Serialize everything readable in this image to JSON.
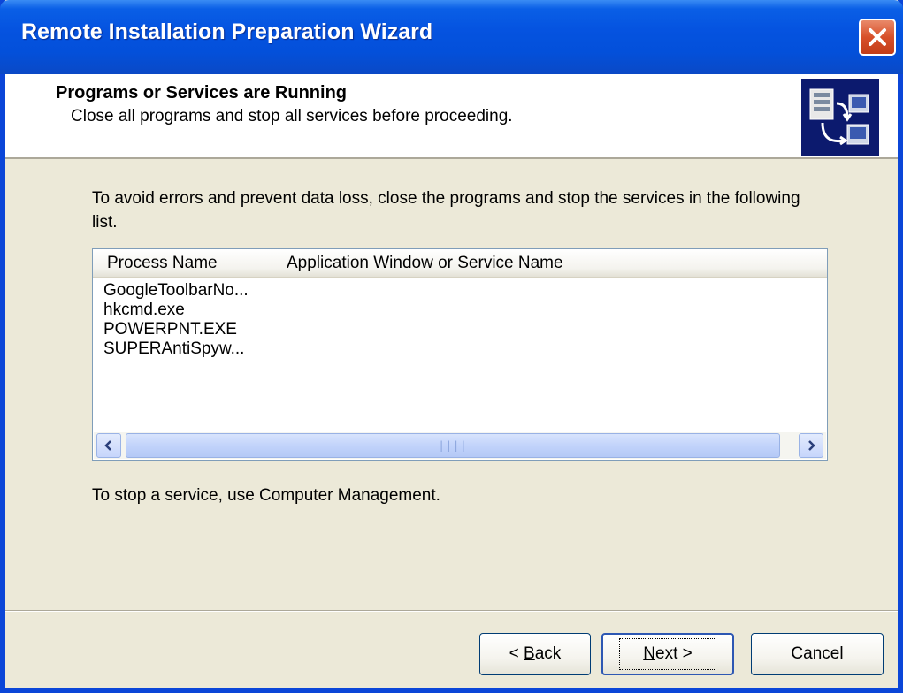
{
  "window": {
    "title": "Remote Installation Preparation Wizard"
  },
  "header": {
    "title": "Programs or Services are Running",
    "subtitle": "Close all programs and stop all services before proceeding."
  },
  "content": {
    "intro": "To avoid errors and prevent data loss, close the programs and stop the services in the following list.",
    "footnote": "To stop a service, use Computer Management."
  },
  "list": {
    "columns": [
      "Process Name",
      "Application Window or Service Name"
    ],
    "rows": [
      {
        "process": "GoogleToolbarNo...",
        "name": ""
      },
      {
        "process": "hkcmd.exe",
        "name": ""
      },
      {
        "process": "POWERPNT.EXE",
        "name": ""
      },
      {
        "process": "SUPERAntiSpyw...",
        "name": ""
      }
    ]
  },
  "buttons": {
    "back_prefix": "< ",
    "back_mnemonic": "B",
    "back_rest": "ack",
    "next_mnemonic": "N",
    "next_rest": "ext >",
    "cancel": "Cancel"
  },
  "colors": {
    "titlebar": "#0553e0",
    "dialog_bg": "#ece9d8",
    "close_button": "#d8502a"
  }
}
